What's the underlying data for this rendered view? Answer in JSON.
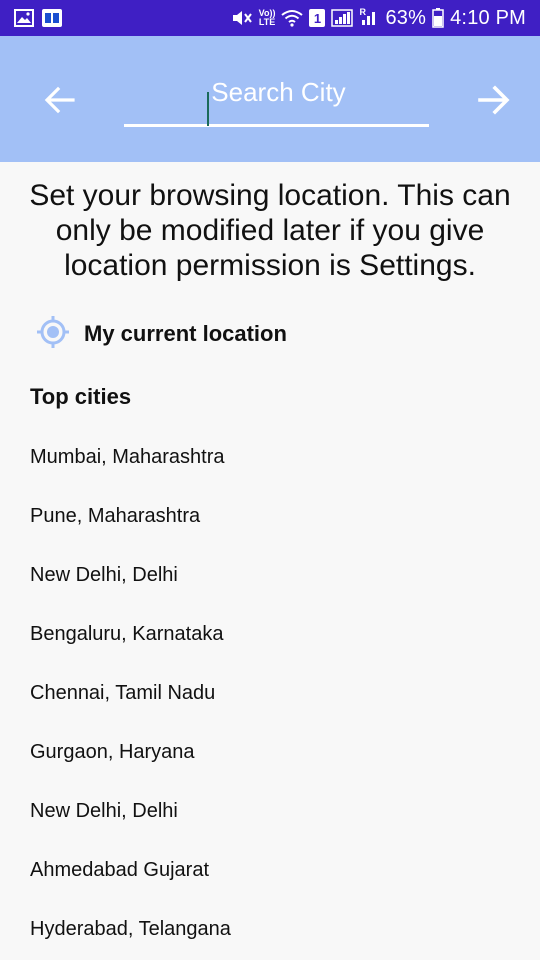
{
  "status_bar": {
    "volte_top": "Vo))",
    "volte_bottom": "LTE",
    "sim_badge": "1",
    "roaming_letter": "R",
    "battery_percent": "63%",
    "time": "4:10 PM",
    "background_color": "#3f1fc4"
  },
  "app_bar": {
    "background_color": "#a2c0f6",
    "search_placeholder": "Search City",
    "search_value": "",
    "back_icon": "arrow-left-icon",
    "go_icon": "arrow-right-icon"
  },
  "intro_text": "Set your browsing location. This can only be modified later if you give location permission is Settings.",
  "current_location": {
    "label": "My current location",
    "icon": "gps-target-icon",
    "icon_color": "#a2c0f6"
  },
  "top_cities": {
    "heading": "Top cities",
    "items": [
      "Mumbai, Maharashtra",
      "Pune, Maharashtra",
      "New Delhi, Delhi",
      "Bengaluru, Karnataka",
      "Chennai, Tamil Nadu",
      "Gurgaon, Haryana",
      "New Delhi, Delhi",
      "Ahmedabad Gujarat",
      "Hyderabad, Telangana"
    ]
  }
}
